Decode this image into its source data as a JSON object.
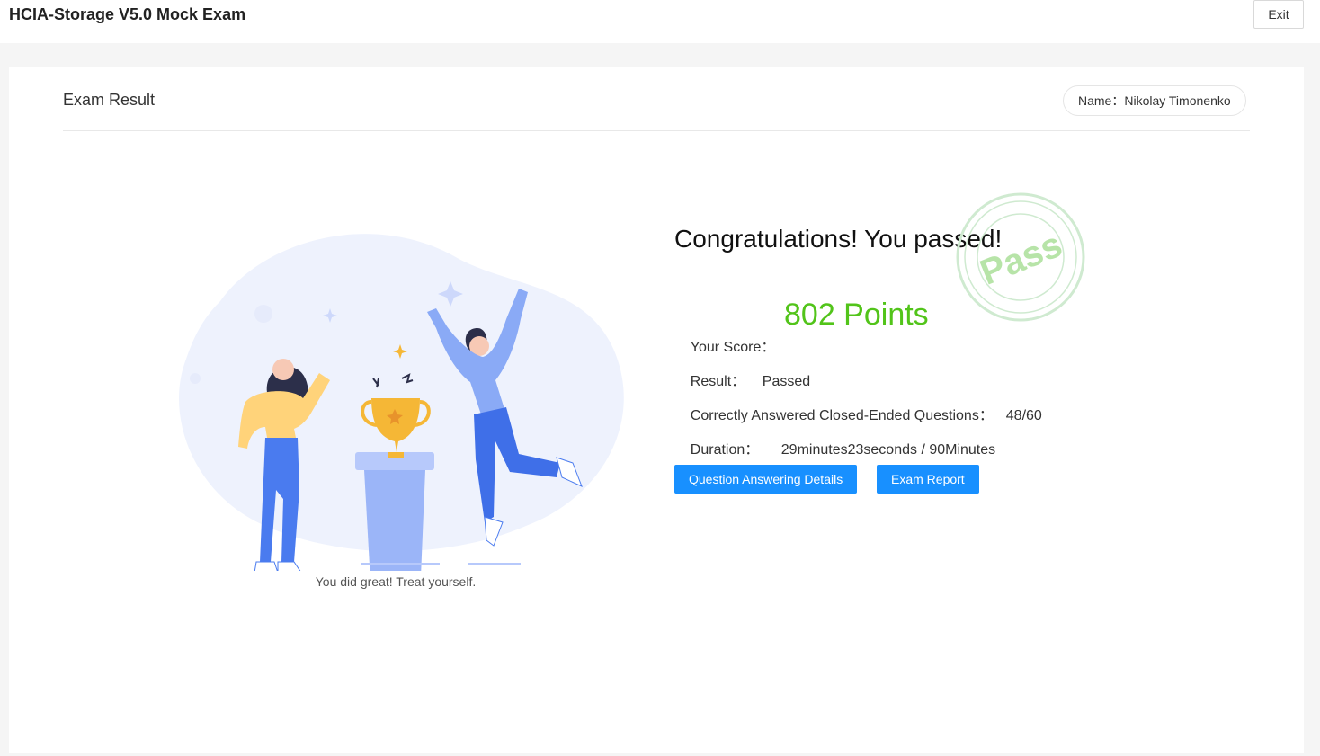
{
  "header": {
    "title": "HCIA-Storage V5.0 Mock Exam",
    "exit_label": "Exit"
  },
  "result_card": {
    "title": "Exam Result",
    "name_label": "Name：",
    "name_value": "Nikolay Timonenko",
    "caption": "You did great! Treat yourself.",
    "headline": "Congratulations! You passed!",
    "stamp_text": "Pass",
    "score_label": "Your Score：",
    "score_value": "802 Points",
    "result_label": "Result：",
    "result_value": "Passed",
    "correct_label": "Correctly Answered Closed-Ended Questions：",
    "correct_value": "48/60",
    "duration_label": "Duration：",
    "duration_value": "29minutes23seconds / 90Minutes",
    "details_button": "Question Answering Details",
    "report_button": "Exam Report"
  },
  "colors": {
    "primary": "#1890ff",
    "score": "#52c41a",
    "stamp": "#b7e4a8"
  },
  "icons": [
    "trophy-illustration",
    "pass-stamp-icon"
  ]
}
